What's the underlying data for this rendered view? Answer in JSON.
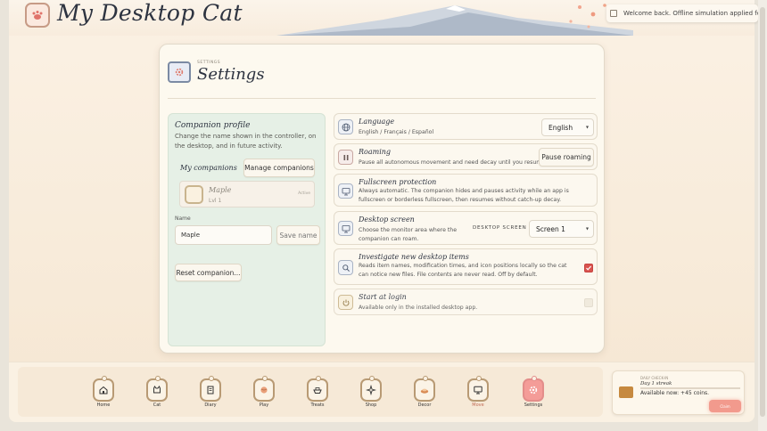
{
  "app": {
    "title": "My Desktop Cat"
  },
  "toast": {
    "message": "Welcome back. Offline simulation applied for th..."
  },
  "settings": {
    "kicker": "SETTINGS",
    "title": "Settings",
    "profile": {
      "title": "Companion profile",
      "description": "Change the name shown in the controller, on the desktop, and in future activity.",
      "my_companions_label": "My companions",
      "manage_button": "Manage companions",
      "companion": {
        "name": "Maple",
        "level": "Lvl 1",
        "status": "Active"
      },
      "name_label": "Name",
      "name_value": "Maple",
      "save_button": "Save name",
      "reset_button": "Reset companion..."
    },
    "rows": [
      {
        "title": "Language",
        "desc": "English / Français / Español",
        "control_value": "English"
      },
      {
        "title": "Roaming",
        "desc": "Pause all autonomous movement and need decay until you resume.",
        "button": "Pause roaming"
      },
      {
        "title": "Fullscreen protection",
        "desc": "Always automatic. The companion hides and pauses activity while an app is fullscreen or borderless fullscreen, then resumes without catch-up decay."
      },
      {
        "title": "Desktop screen",
        "desc": "Choose the monitor area where the companion can roam.",
        "control_label": "DESKTOP SCREEN",
        "control_value": "Screen 1"
      },
      {
        "title": "Investigate new desktop items",
        "desc": "Reads item names, modification times, and icon positions locally so the cat can notice new files. File contents are never read. Off by default.",
        "checked": true
      },
      {
        "title": "Start at login",
        "desc": "Available only in the installed desktop app.",
        "checked": false
      }
    ]
  },
  "dock": {
    "items": [
      {
        "label": "Home",
        "icon": "house-icon"
      },
      {
        "label": "Cat",
        "icon": "cat-face-icon"
      },
      {
        "label": "Diary",
        "icon": "book-icon"
      },
      {
        "label": "Play",
        "icon": "yarn-icon"
      },
      {
        "label": "Treats",
        "icon": "food-bowl-icon"
      },
      {
        "label": "Shop",
        "icon": "sparkle-icon"
      },
      {
        "label": "Decor",
        "icon": "bed-icon"
      },
      {
        "label": "Move",
        "icon": "monitor-icon"
      },
      {
        "label": "Settings",
        "icon": "gear-icon"
      }
    ],
    "active": "Settings"
  },
  "bonus": {
    "kicker": "DAILY CHECK-IN",
    "title": "Day 1 streak",
    "available": "Available now: +45 coins.",
    "claim": "Claim"
  },
  "colors": {
    "accent": "#f49c98",
    "panel": "#fdf9ef",
    "profile_bg": "#e6f0e6",
    "checkbox_on": "#d9534f"
  }
}
